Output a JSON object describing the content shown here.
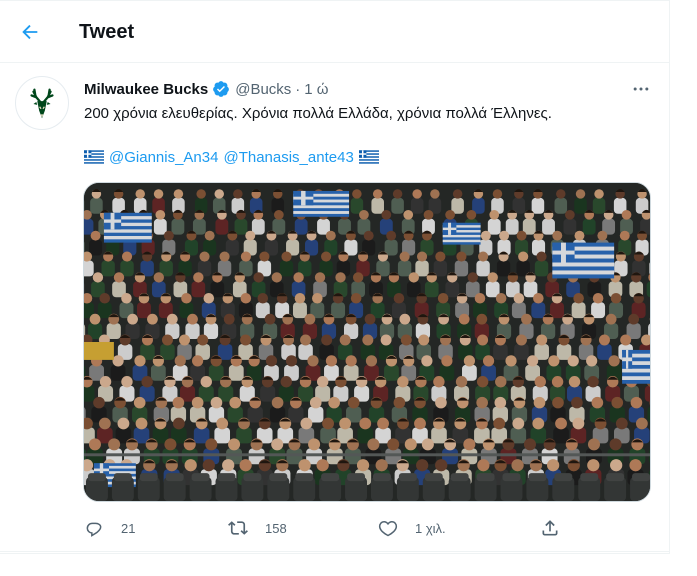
{
  "header": {
    "title": "Tweet"
  },
  "tweet": {
    "display_name": "Milwaukee Bucks",
    "handle": "@Bucks",
    "separator": "·",
    "time": "1 ώ",
    "text": "200 χρόνια ελευθερίας. Χρόνια πολλά Ελλάδα, χρόνια πολλά Έλληνες.",
    "mentions": [
      "@Giannis_An34",
      "@Thanasis_ante43"
    ],
    "flag_icon": "greek-flag-icon",
    "verified_icon": "verified-badge-icon"
  },
  "actions": {
    "reply_count": "21",
    "retweet_count": "158",
    "like_count": "1 χιλ."
  },
  "colors": {
    "accent": "#1d9bf0",
    "text": "#0f1419",
    "secondary": "#536471",
    "border": "#eff3f4",
    "bucks_green": "#00471b"
  }
}
